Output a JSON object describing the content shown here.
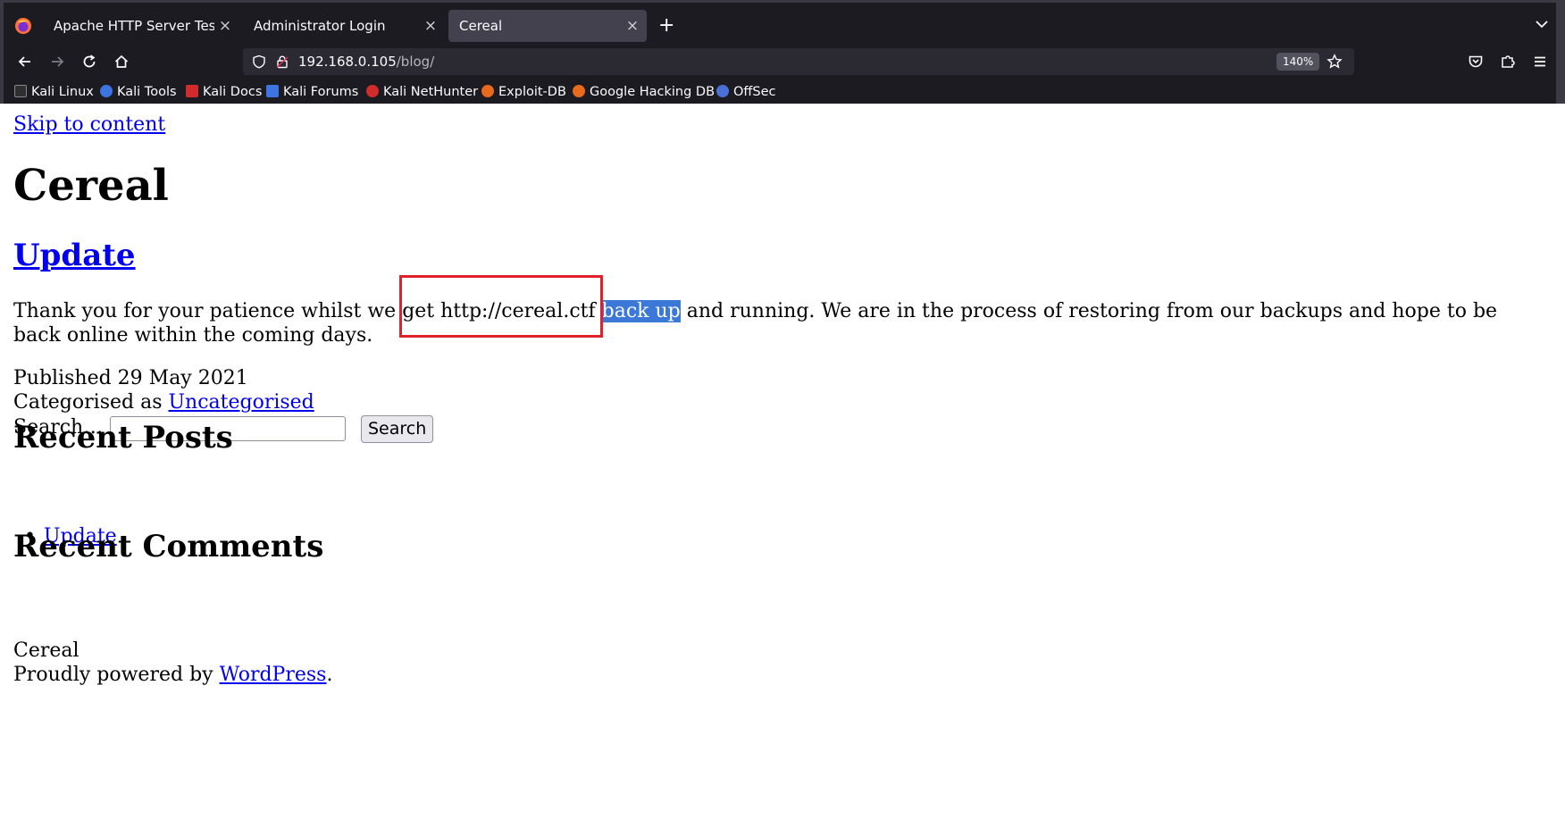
{
  "browser": {
    "tabs": [
      {
        "title": "Apache HTTP Server Test Pa",
        "active": false
      },
      {
        "title": "Administrator Login",
        "active": false
      },
      {
        "title": "Cereal",
        "active": true
      }
    ],
    "tab_close_glyph": "×",
    "new_tab_glyph": "+",
    "url": {
      "host": "192.168.0.105",
      "path": "/blog/"
    },
    "zoom": "140%",
    "bookmarks": [
      {
        "label": "Kali Linux",
        "color": "#2f2f2f"
      },
      {
        "label": "Kali Tools",
        "color": "#3d74e0"
      },
      {
        "label": "Kali Docs",
        "color": "#d22b2b"
      },
      {
        "label": "Kali Forums",
        "color": "#3d74e0"
      },
      {
        "label": "Kali NetHunter",
        "color": "#d22b2b"
      },
      {
        "label": "Exploit-DB",
        "color": "#e86a1c"
      },
      {
        "label": "Google Hacking DB",
        "color": "#e86a1c"
      },
      {
        "label": "OffSec",
        "color": "#4a6fd6"
      }
    ]
  },
  "page": {
    "skip_link": "Skip to content",
    "site_title": "Cereal",
    "post": {
      "title": "Update",
      "body_before": "Thank you for your patience whilst we ",
      "body_highlight_box": "get http://cereal.ctf",
      "body_selected": "back up",
      "body_after": " and running. We are in the process of restoring from our backups and hope to be back online within the coming days."
    },
    "published": "Published 29 May 2021",
    "categorised_label": "Categorised as ",
    "category": "Uncategorised",
    "search": {
      "label": "Search…",
      "button": "Search",
      "value": ""
    },
    "recent_posts_heading": "Recent Posts",
    "recent_posts": [
      "Update"
    ],
    "recent_comments_heading": "Recent Comments",
    "footer_site": "Cereal",
    "footer_prefix": "Proudly powered by ",
    "footer_link": "WordPress",
    "footer_suffix": "."
  },
  "colors": {
    "chrome_bg": "#1c1b22",
    "active_tab": "#42414d",
    "link": "#0000ee",
    "selection": "#3b78d8",
    "annotation": "#e0202a"
  }
}
